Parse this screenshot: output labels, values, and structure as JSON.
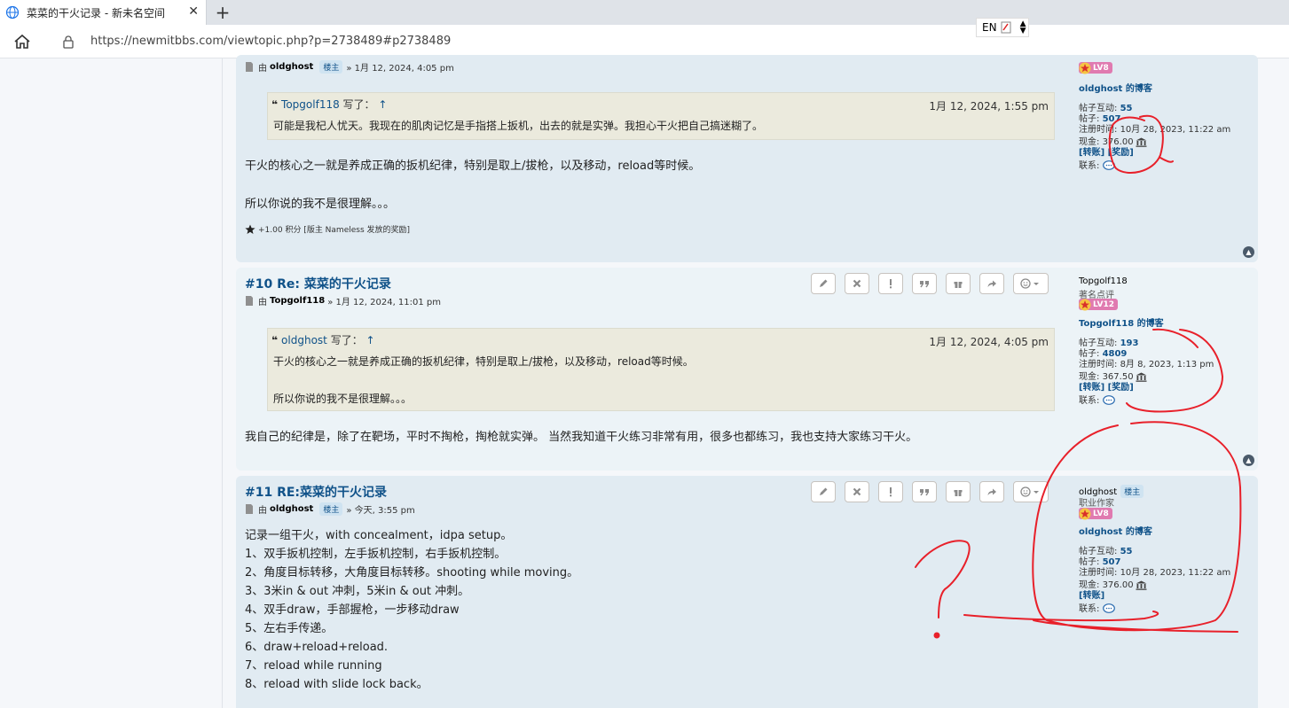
{
  "browser": {
    "tab_title": "菜菜的干火记录 - 新未名空间",
    "url": "https://newmitbbs.com/viewtopic.php?p=2738489#p2738489",
    "lang_indicator": "EN"
  },
  "colors": {
    "accent": "#105289",
    "post_bg": "#e1ebf2",
    "quote_bg": "#ebeadd",
    "annotation": "#e8202a"
  },
  "posts": [
    {
      "author_line_prefix": "由",
      "author": "oldghost",
      "badge": "楼主",
      "date": "» 1月 12, 2024, 4:05 pm",
      "quote": {
        "author": "Topgolf118",
        "wrote": "写了：",
        "arrow": "↑",
        "date": "1月 12, 2024, 1:55 pm",
        "lines": [
          "可能是我杞人忧天。我现在的肌肉记忆是手指搭上扳机，出去的就是实弹。我担心干火把自己搞迷糊了。"
        ]
      },
      "text": [
        "干火的核心之一就是养成正确的扳机纪律，特别是取上/拔枪，以及移动，reload等时候。",
        "所以你说的我不是很理解。。。"
      ],
      "karma": "+1.00 积分 [版主 Nameless 发放的奖励]",
      "profile": {
        "level": "LV8",
        "blog": "oldghost 的博客",
        "interact_label": "帖子互动:",
        "interact": "55",
        "posts_label": "帖子:",
        "posts": "507",
        "reg_label": "注册时间:",
        "reg": "10月 28, 2023, 11:22 am",
        "cash_label": "现金:",
        "cash": "376.00",
        "links": "[转账] [奖励]",
        "contact_label": "联系:"
      }
    },
    {
      "title": "#10 Re: 菜菜的干火记录",
      "author_line_prefix": "由",
      "author": "Topgolf118",
      "date": "» 1月 12, 2024, 11:01 pm",
      "quote": {
        "author": "oldghost",
        "wrote": "写了：",
        "arrow": "↑",
        "date": "1月 12, 2024, 4:05 pm",
        "lines": [
          "干火的核心之一就是养成正确的扳机纪律，特别是取上/拔枪，以及移动，reload等时候。",
          "所以你说的我不是很理解。。。"
        ]
      },
      "text": [
        "我自己的纪律是，除了在靶场，平时不掏枪，掏枪就实弹。 当然我知道干火练习非常有用，很多也都练习，我也支持大家练习干火。"
      ],
      "profile": {
        "name": "Topgolf118",
        "rank": "著名点评",
        "level": "LV12",
        "blog": "Topgolf118 的博客",
        "interact_label": "帖子互动:",
        "interact": "193",
        "posts_label": "帖子:",
        "posts": "4809",
        "reg_label": "注册时间:",
        "reg": "8月 8, 2023, 1:13 pm",
        "cash_label": "现金:",
        "cash": "367.50",
        "links": "[转账] [奖励]",
        "contact_label": "联系:"
      }
    },
    {
      "title": "#11 RE:菜菜的干火记录",
      "author_line_prefix": "由",
      "author": "oldghost",
      "badge": "楼主",
      "date": "» 今天, 3:55 pm",
      "text": [
        "记录一组干火，with concealment，idpa setup。",
        "1、双手扳机控制，左手扳机控制，右手扳机控制。",
        "2、角度目标转移，大角度目标转移。shooting while moving。",
        "3、3米in & out 冲刺，5米in & out 冲刺。",
        "4、双手draw，手部握枪，一步移动draw",
        "5、左右手传递。",
        "6、draw+reload+reload.",
        "7、reload while running",
        "8、reload with slide lock back。"
      ],
      "profile": {
        "name": "oldghost",
        "badge": "楼主",
        "rank": "职业作家",
        "level": "LV8",
        "blog": "oldghost 的博客",
        "interact_label": "帖子互动:",
        "interact": "55",
        "posts_label": "帖子:",
        "posts": "507",
        "reg_label": "注册时间:",
        "reg": "10月 28, 2023, 11:22 am",
        "cash_label": "现金:",
        "cash": "376.00",
        "links": "[转账]",
        "contact_label": "联系:"
      }
    }
  ]
}
